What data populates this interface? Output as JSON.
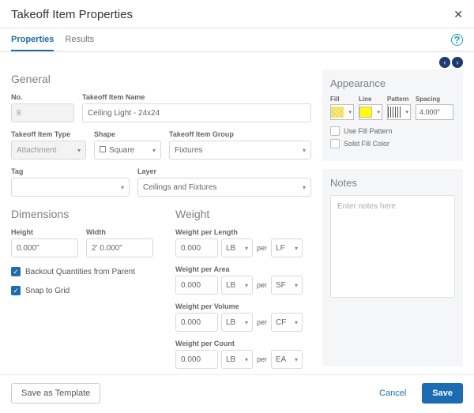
{
  "dialog": {
    "title": "Takeoff Item Properties"
  },
  "tabs": {
    "properties": "Properties",
    "results": "Results"
  },
  "general": {
    "heading": "General",
    "no_label": "No.",
    "no_value": "8",
    "name_label": "Takeoff Item Name",
    "name_value": "Ceiling Light - 24x24",
    "type_label": "Takeoff Item Type",
    "type_value": "Attachment",
    "shape_label": "Shape",
    "shape_value": "Square",
    "group_label": "Takeoff Item Group",
    "group_value": "Fixtures",
    "tag_label": "Tag",
    "tag_value": "",
    "layer_label": "Layer",
    "layer_value": "Ceilings and Fixtures"
  },
  "dimensions": {
    "heading": "Dimensions",
    "height_label": "Height",
    "height_value": "0.000\"",
    "width_label": "Width",
    "width_value": "2' 0.000\"",
    "backout": "Backout Quantities from Parent",
    "snap": "Snap to Grid"
  },
  "weight": {
    "heading": "Weight",
    "per": "per",
    "groups": [
      {
        "label": "Weight per Length",
        "value": "0.000",
        "unit": "LB",
        "by": "LF"
      },
      {
        "label": "Weight per Area",
        "value": "0.000",
        "unit": "LB",
        "by": "SF"
      },
      {
        "label": "Weight per Volume",
        "value": "0.000",
        "unit": "LB",
        "by": "CF"
      },
      {
        "label": "Weight per Count",
        "value": "0.000",
        "unit": "LB",
        "by": "EA"
      }
    ]
  },
  "appearance": {
    "heading": "Appearance",
    "fill_label": "Fill",
    "line_label": "Line",
    "pattern_label": "Pattern",
    "spacing_label": "Spacing",
    "spacing_value": "4.000\"",
    "use_fill_pattern": "Use Fill Pattern",
    "solid_fill_color": "Solid Fill Color"
  },
  "notes": {
    "heading": "Notes",
    "placeholder": "Enter notes here"
  },
  "footer": {
    "save_template": "Save as Template",
    "cancel": "Cancel",
    "save": "Save"
  }
}
